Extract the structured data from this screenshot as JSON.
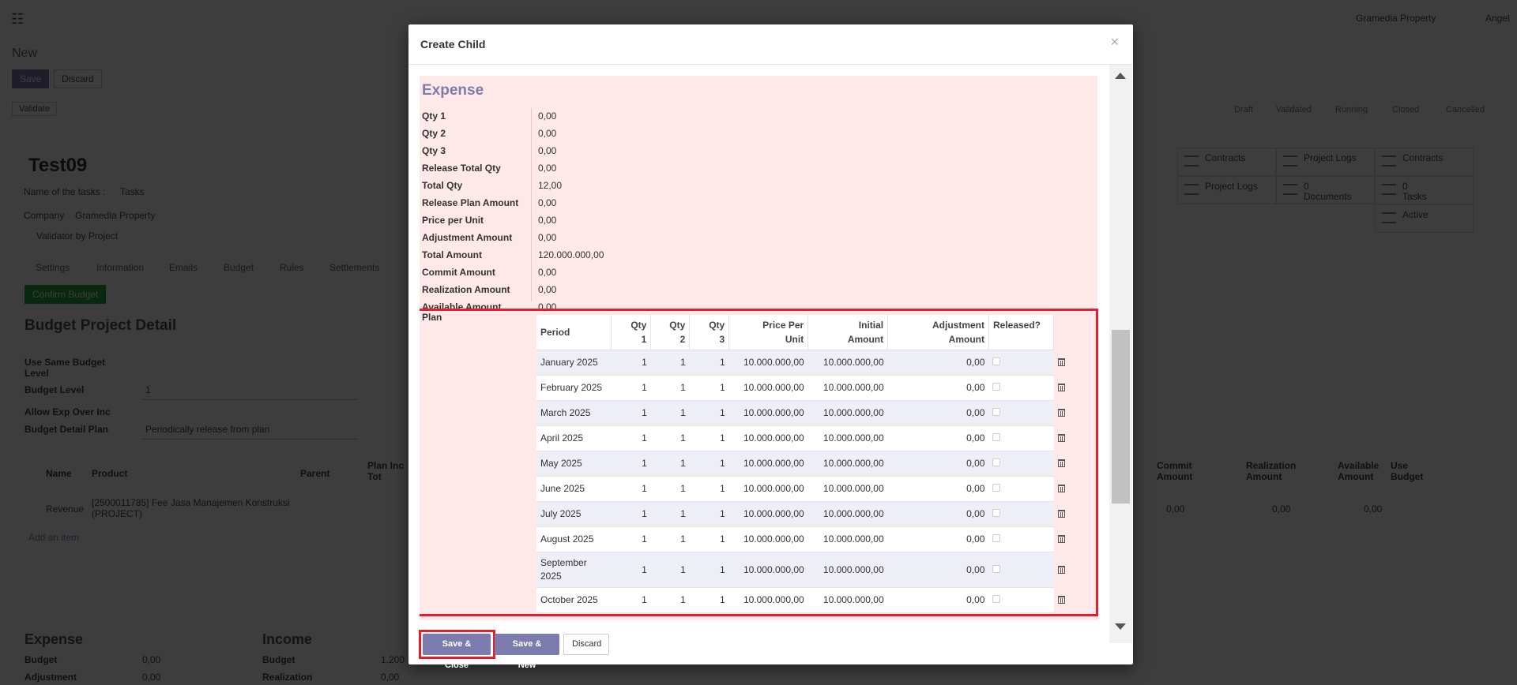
{
  "background": {
    "topbar": {
      "company": "Gramedia Property",
      "user": "Angel"
    },
    "breadcrumb": "New",
    "save_label": "Save",
    "discard_label": "Discard",
    "validate_label": "Validate",
    "stages": [
      "Draft",
      "Validated",
      "Running",
      "Closed",
      "Cancelled"
    ],
    "record_title": "Test09",
    "tasks_label": "Name of the tasks :",
    "tasks_value": "Tasks",
    "company_label": "Company",
    "company_value": "Gramedia Property",
    "validator_label": "Validator by Project",
    "tabs": [
      "Settings",
      "Information",
      "Emails",
      "Budget",
      "Rules",
      "Settlements"
    ],
    "confirm_budget": "Confirm Budget",
    "section_title": "Budget Project Detail",
    "fields": [
      {
        "label": "Use Same Budget Level",
        "value": ""
      },
      {
        "label": "Budget Level",
        "value": "1"
      },
      {
        "label": "Allow Exp Over Inc",
        "value": ""
      },
      {
        "label": "Budget Detail Plan",
        "value": "Periodically release from plan"
      }
    ],
    "stat_buttons": [
      {
        "label": "Contracts"
      },
      {
        "label": "Project Logs"
      },
      {
        "label": "Contracts"
      },
      {
        "label": "Project Logs"
      },
      {
        "label": "0 Documents"
      },
      {
        "label": "0 Tasks"
      },
      {
        "label": "Active"
      }
    ],
    "grid_headers": [
      "Name",
      "Product",
      "Parent",
      "Plan Inc Tot",
      "Commit Amount",
      "Realization Amount",
      "Available Amount",
      "Use Budget"
    ],
    "grid_row": {
      "name": "Revenue",
      "product": "[2500011785] Fee Jasa Manajemen Konstruksi (PROJECT)",
      "commit": "0,00",
      "realization": "0,00",
      "available": "0,00"
    },
    "add_item": "Add an item",
    "summary": {
      "expense_title": "Expense",
      "income_title": "Income",
      "expense_rows": [
        {
          "label": "Budget",
          "value": "0,00"
        },
        {
          "label": "Adjustment",
          "value": "0,00"
        }
      ],
      "income_rows": [
        {
          "label": "Budget",
          "value": "1.200"
        },
        {
          "label": "Realization",
          "value": "0,00"
        }
      ]
    }
  },
  "modal": {
    "title": "Create Child",
    "close_icon": "×",
    "section_title": "Expense",
    "fields": [
      {
        "label": "Qty 1",
        "value": "0,00"
      },
      {
        "label": "Qty 2",
        "value": "0,00"
      },
      {
        "label": "Qty 3",
        "value": "0,00"
      },
      {
        "label": "Release Total Qty",
        "value": "0,00"
      },
      {
        "label": "Total Qty",
        "value": "12,00"
      },
      {
        "label": "Release Plan Amount",
        "value": "0,00"
      },
      {
        "label": "Price per Unit",
        "value": "0,00"
      },
      {
        "label": "Adjustment Amount",
        "value": "0,00"
      },
      {
        "label": "Total Amount",
        "value": "120.000.000,00"
      },
      {
        "label": "Commit Amount",
        "value": "0,00"
      },
      {
        "label": "Realization Amount",
        "value": "0,00"
      },
      {
        "label": "Available Amount",
        "value": "0,00"
      }
    ],
    "plan_label": "Plan",
    "plan_headers": {
      "period": "Period",
      "qty1_a": "Qty",
      "qty1_b": "1",
      "qty2_a": "Qty",
      "qty2_b": "2",
      "qty3_a": "Qty",
      "qty3_b": "3",
      "price_a": "Price Per",
      "price_b": "Unit",
      "initial_a": "Initial",
      "initial_b": "Amount",
      "adj_a": "Adjustment",
      "adj_b": "Amount",
      "released": "Released?"
    },
    "plan_rows": [
      {
        "period": "January 2025",
        "qty1": "1",
        "qty2": "1",
        "qty3": "1",
        "price": "10.000.000,00",
        "initial": "10.000.000,00",
        "adjustment": "0,00"
      },
      {
        "period": "February 2025",
        "qty1": "1",
        "qty2": "1",
        "qty3": "1",
        "price": "10.000.000,00",
        "initial": "10.000.000,00",
        "adjustment": "0,00"
      },
      {
        "period": "March 2025",
        "qty1": "1",
        "qty2": "1",
        "qty3": "1",
        "price": "10.000.000,00",
        "initial": "10.000.000,00",
        "adjustment": "0,00"
      },
      {
        "period": "April 2025",
        "qty1": "1",
        "qty2": "1",
        "qty3": "1",
        "price": "10.000.000,00",
        "initial": "10.000.000,00",
        "adjustment": "0,00"
      },
      {
        "period": "May 2025",
        "qty1": "1",
        "qty2": "1",
        "qty3": "1",
        "price": "10.000.000,00",
        "initial": "10.000.000,00",
        "adjustment": "0,00"
      },
      {
        "period": "June 2025",
        "qty1": "1",
        "qty2": "1",
        "qty3": "1",
        "price": "10.000.000,00",
        "initial": "10.000.000,00",
        "adjustment": "0,00"
      },
      {
        "period": "July 2025",
        "qty1": "1",
        "qty2": "1",
        "qty3": "1",
        "price": "10.000.000,00",
        "initial": "10.000.000,00",
        "adjustment": "0,00"
      },
      {
        "period": "August 2025",
        "qty1": "1",
        "qty2": "1",
        "qty3": "1",
        "price": "10.000.000,00",
        "initial": "10.000.000,00",
        "adjustment": "0,00"
      },
      {
        "period": "September 2025",
        "qty1": "1",
        "qty2": "1",
        "qty3": "1",
        "price": "10.000.000,00",
        "initial": "10.000.000,00",
        "adjustment": "0,00"
      },
      {
        "period": "October 2025",
        "qty1": "1",
        "qty2": "1",
        "qty3": "1",
        "price": "10.000.000,00",
        "initial": "10.000.000,00",
        "adjustment": "0,00"
      }
    ],
    "buttons": {
      "save_close": "Save & Close",
      "save_new": "Save & New",
      "discard": "Discard"
    },
    "colors": {
      "accent": "#7c7bad",
      "highlight": "#e02030",
      "pink": "#ffe8e8"
    }
  }
}
